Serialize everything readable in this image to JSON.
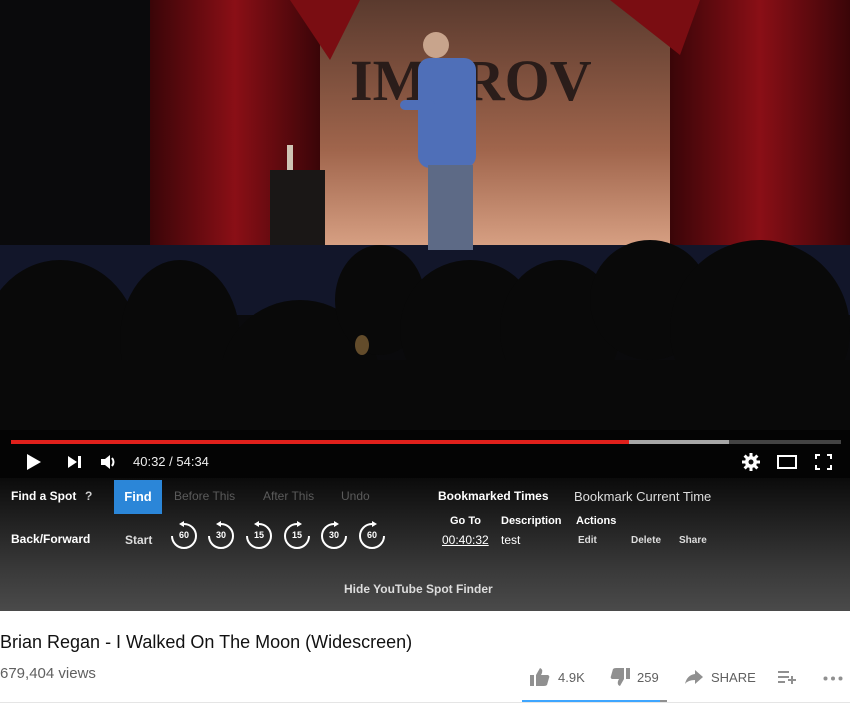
{
  "player": {
    "time_current": "40:32",
    "time_total": "54:34",
    "time_display": "40:32 / 54:34",
    "progress_played_fraction": 0.745,
    "progress_buffered_fraction": 0.865,
    "stage_sign": "IMPROV"
  },
  "spot_finder": {
    "find_a_spot_label": "Find a Spot",
    "help_label": "?",
    "find_button": "Find",
    "before_this": "Before This",
    "after_this": "After This",
    "undo": "Undo",
    "back_forward_label": "Back/Forward",
    "start_label": "Start",
    "skip_buttons": [
      "60",
      "30",
      "15",
      "15",
      "30",
      "60"
    ],
    "bookmarked_times_label": "Bookmarked Times",
    "bookmark_current_label": "Bookmark Current Time",
    "columns": {
      "goto": "Go To",
      "description": "Description",
      "actions": "Actions"
    },
    "bookmark": {
      "time": "00:40:32",
      "description": "test",
      "edit": "Edit",
      "delete": "Delete",
      "share": "Share"
    },
    "hide_label": "Hide YouTube Spot Finder"
  },
  "video_info": {
    "title": "Brian Regan - I Walked On The Moon (Widescreen)",
    "views": "679,404 views",
    "likes": "4.9K",
    "dislikes": "259",
    "share": "SHARE",
    "like_ratio": 0.95
  },
  "colors": {
    "progress_red": "#e0201b",
    "find_blue": "#2b86d8",
    "like_blue": "#3ea6ff"
  }
}
